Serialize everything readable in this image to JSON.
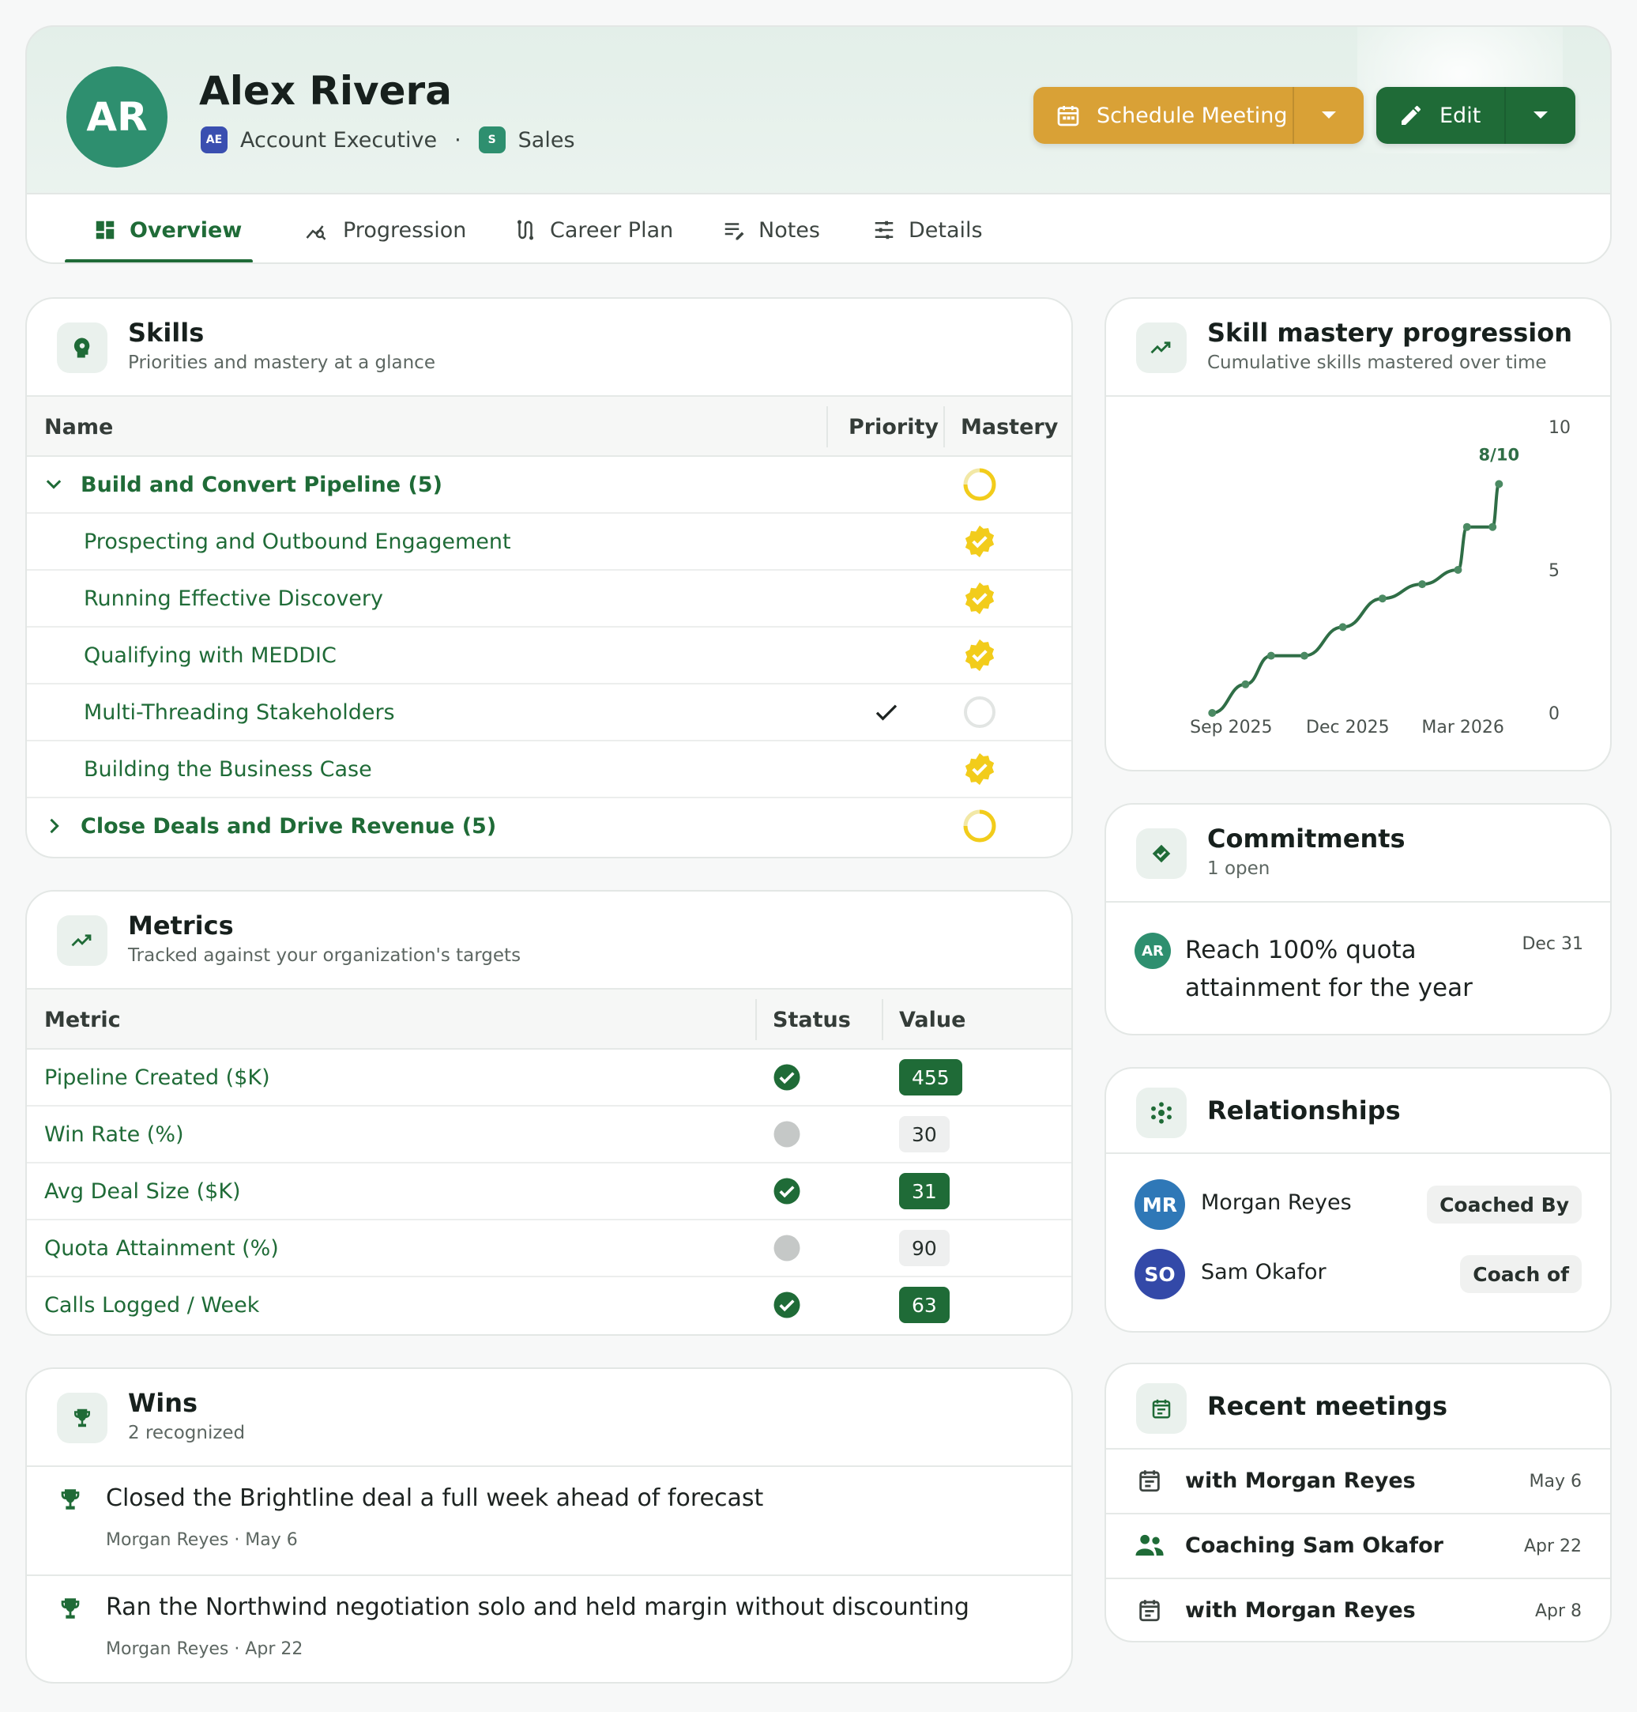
{
  "header": {
    "initials": "AR",
    "name": "Alex Rivera",
    "role_chip": "AE",
    "role": "Account Executive",
    "dept_chip": "S",
    "dept": "Sales",
    "schedule_label": "Schedule Meeting",
    "edit_label": "Edit",
    "colors": {
      "primary": "#1f6b37",
      "accent": "#d9a136",
      "avatar": "#2e8f6f"
    }
  },
  "tabs": [
    {
      "label": "Overview",
      "icon": "dashboard-icon",
      "active": true
    },
    {
      "label": "Progression",
      "icon": "insights-icon"
    },
    {
      "label": "Career Plan",
      "icon": "route-icon"
    },
    {
      "label": "Notes",
      "icon": "notes-icon"
    },
    {
      "label": "Details",
      "icon": "tune-icon"
    }
  ],
  "skills": {
    "title": "Skills",
    "subtitle": "Priorities and mastery at a glance",
    "columns": {
      "name": "Name",
      "priority": "Priority",
      "mastery": "Mastery"
    },
    "rows": [
      {
        "label": "Build and Convert Pipeline (5)",
        "type": "group",
        "expanded": true,
        "mastery": "partial"
      },
      {
        "label": "Prospecting and Outbound Engagement",
        "type": "skill",
        "mastery": "mastered"
      },
      {
        "label": "Running Effective Discovery",
        "type": "skill",
        "mastery": "mastered"
      },
      {
        "label": "Qualifying with MEDDIC",
        "type": "skill",
        "mastery": "mastered"
      },
      {
        "label": "Multi-Threading Stakeholders",
        "type": "skill",
        "priority": true,
        "mastery": "none"
      },
      {
        "label": "Building the Business Case",
        "type": "skill",
        "mastery": "mastered"
      },
      {
        "label": "Close Deals and Drive Revenue (5)",
        "type": "group",
        "expanded": false,
        "mastery": "partial"
      }
    ]
  },
  "metrics": {
    "title": "Metrics",
    "subtitle": "Tracked against your organization's targets",
    "columns": {
      "metric": "Metric",
      "status": "Status",
      "value": "Value"
    },
    "rows": [
      {
        "label": "Pipeline Created ($K)",
        "status": "on-track",
        "value": "455"
      },
      {
        "label": "Win Rate (%)",
        "status": "neutral",
        "value": "30"
      },
      {
        "label": "Avg Deal Size ($K)",
        "status": "on-track",
        "value": "31"
      },
      {
        "label": "Quota Attainment (%)",
        "status": "neutral",
        "value": "90"
      },
      {
        "label": "Calls Logged / Week",
        "status": "on-track",
        "value": "63"
      }
    ]
  },
  "wins": {
    "title": "Wins",
    "subtitle": "2 recognized",
    "items": [
      {
        "text": "Closed the Brightline deal a full week ahead of forecast",
        "meta": "Morgan Reyes · May 6"
      },
      {
        "text": "Ran the Northwind negotiation solo and held margin without discounting",
        "meta": "Morgan Reyes · Apr 22"
      }
    ]
  },
  "progression": {
    "title": "Skill mastery progression",
    "subtitle": "Cumulative skills mastered over time",
    "end_label": "8/10"
  },
  "chart_data": {
    "type": "line",
    "x": [
      "2025-08-25",
      "2025-09-20",
      "2025-10-10",
      "2025-11-05",
      "2025-12-05",
      "2026-01-05",
      "2026-02-05",
      "2026-03-05",
      "2026-03-12",
      "2026-04-01",
      "2026-04-06"
    ],
    "y": [
      0,
      1,
      2,
      2,
      3,
      4,
      4.5,
      5,
      6.5,
      6.5,
      8
    ],
    "x_ticks": [
      "Sep 2025",
      "Dec 2025",
      "Mar 2026"
    ],
    "y_ticks": [
      "0",
      "5",
      "10"
    ],
    "ylim": [
      0,
      10
    ],
    "y_axis_side": "right",
    "grid": false,
    "line_color": "#2f6e46"
  },
  "commitments": {
    "title": "Commitments",
    "subtitle": "1 open",
    "items": [
      {
        "initials": "AR",
        "text_line1": "Reach 100% quota",
        "text_line2": "attainment for the year",
        "due": "Dec 31"
      }
    ]
  },
  "relationships": {
    "title": "Relationships",
    "items": [
      {
        "initials": "MR",
        "name": "Morgan Reyes",
        "relation": "Coached By",
        "color": "#2f78b7"
      },
      {
        "initials": "SO",
        "name": "Sam Okafor",
        "relation": "Coach of",
        "color": "#3349a8"
      }
    ]
  },
  "meetings": {
    "title": "Recent meetings",
    "items": [
      {
        "icon": "calendar-icon",
        "label": "with Morgan Reyes",
        "date": "May 6"
      },
      {
        "icon": "people-icon",
        "label": "Coaching Sam Okafor",
        "date": "Apr 22"
      },
      {
        "icon": "calendar-icon",
        "label": "with Morgan Reyes",
        "date": "Apr 8"
      }
    ]
  }
}
